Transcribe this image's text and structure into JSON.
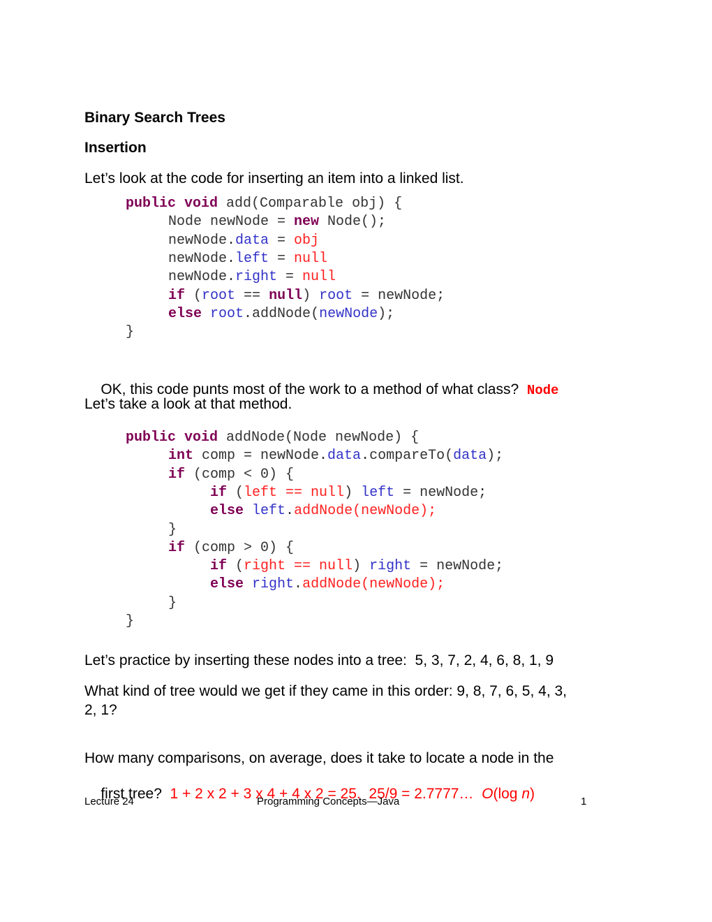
{
  "document": {
    "title": "Binary Search Trees",
    "subtitle": "Insertion",
    "intro": "Let’s look at the code for inserting an item into a linked list.",
    "code_add": [
      [
        {
          "t": "public void",
          "c": "kw"
        },
        {
          "t": " add(Comparable obj) {",
          "c": ""
        }
      ],
      [
        {
          "t": "Node newNode = ",
          "c": ""
        },
        {
          "t": "new",
          "c": "kw"
        },
        {
          "t": " Node();",
          "c": ""
        }
      ],
      [
        {
          "t": "newNode.",
          "c": ""
        },
        {
          "t": "data",
          "c": "bl"
        },
        {
          "t": " = ",
          "c": ""
        },
        {
          "t": "obj",
          "c": "rd"
        }
      ],
      [
        {
          "t": "newNode.",
          "c": ""
        },
        {
          "t": "left",
          "c": "bl"
        },
        {
          "t": " = ",
          "c": ""
        },
        {
          "t": "null",
          "c": "rd"
        }
      ],
      [
        {
          "t": "newNode.",
          "c": ""
        },
        {
          "t": "right",
          "c": "bl"
        },
        {
          "t": " = ",
          "c": ""
        },
        {
          "t": "null",
          "c": "rd"
        }
      ],
      [
        {
          "t": "if",
          "c": "kw"
        },
        {
          "t": " (",
          "c": ""
        },
        {
          "t": "root",
          "c": "bl"
        },
        {
          "t": " == ",
          "c": ""
        },
        {
          "t": "null",
          "c": "kw"
        },
        {
          "t": ") ",
          "c": ""
        },
        {
          "t": "root",
          "c": "bl"
        },
        {
          "t": " = newNode;",
          "c": ""
        }
      ],
      [
        {
          "t": "else",
          "c": "kw"
        },
        {
          "t": " ",
          "c": ""
        },
        {
          "t": "root",
          "c": "bl"
        },
        {
          "t": ".addNode(",
          "c": ""
        },
        {
          "t": "newNode",
          "c": "bl"
        },
        {
          "t": ");",
          "c": ""
        }
      ],
      [
        {
          "t": "}",
          "c": ""
        }
      ]
    ],
    "question1": "OK, this code punts most of the work to a method of what class?",
    "answer1": "Node",
    "lead2": "Let’s take a look at that method.",
    "code_addnode": [
      [
        {
          "t": "public void",
          "c": "kw"
        },
        {
          "t": " addNode(Node newNode) {",
          "c": ""
        }
      ],
      [
        {
          "t": "int",
          "c": "kw"
        },
        {
          "t": " comp = newNode.",
          "c": ""
        },
        {
          "t": "data",
          "c": "bl"
        },
        {
          "t": ".compareTo(",
          "c": ""
        },
        {
          "t": "data",
          "c": "bl"
        },
        {
          "t": ");",
          "c": ""
        }
      ],
      [
        {
          "t": "if",
          "c": "kw"
        },
        {
          "t": " (comp < 0) {",
          "c": ""
        }
      ],
      [
        {
          "t": "if",
          "c": "kw"
        },
        {
          "t": " (",
          "c": ""
        },
        {
          "t": "left == null",
          "c": "rd"
        },
        {
          "t": ") ",
          "c": ""
        },
        {
          "t": "left",
          "c": "bl"
        },
        {
          "t": " = newNode;",
          "c": ""
        }
      ],
      [
        {
          "t": "else",
          "c": "kw"
        },
        {
          "t": " ",
          "c": ""
        },
        {
          "t": "left",
          "c": "bl"
        },
        {
          "t": ".",
          "c": ""
        },
        {
          "t": "addNode(newNode);",
          "c": "rd"
        }
      ],
      [
        {
          "t": "}",
          "c": ""
        }
      ],
      [
        {
          "t": "if",
          "c": "kw"
        },
        {
          "t": " (comp > 0) {",
          "c": ""
        }
      ],
      [
        {
          "t": "if",
          "c": "kw"
        },
        {
          "t": " (",
          "c": ""
        },
        {
          "t": "right == null",
          "c": "rd"
        },
        {
          "t": ") ",
          "c": ""
        },
        {
          "t": "right",
          "c": "bl"
        },
        {
          "t": " = newNode;",
          "c": ""
        }
      ],
      [
        {
          "t": "else",
          "c": "kw"
        },
        {
          "t": " ",
          "c": ""
        },
        {
          "t": "right",
          "c": "bl"
        },
        {
          "t": ".",
          "c": ""
        },
        {
          "t": "addNode(newNode);",
          "c": "rd"
        }
      ],
      [
        {
          "t": "}",
          "c": ""
        }
      ],
      [
        {
          "t": "}",
          "c": ""
        }
      ]
    ],
    "practice": "Let’s practice by inserting these nodes into a tree:  5, 3, 7, 2, 4, 6, 8, 1, 9",
    "question2_line1": "What kind of tree would we get if they came in this order: 9, 8, 7, 6, 5, 4, 3,",
    "question2_line2": "2, 1?",
    "question3_line1": "How many comparisons, on average, does it take to locate a node in the",
    "question3_line2_prefix": "first tree?  ",
    "answer3": "1 + 2 x 2 + 3 x 4 + 4 x 2 = 25.  25/9 = 2.7777…  ",
    "answer3_big_o_prefix": "O",
    "answer3_big_o_mid": "(log ",
    "answer3_big_o_var": "n",
    "answer3_big_o_suffix": ")"
  },
  "footer": {
    "left": "Lecture 24",
    "center": "Programming Concepts—Java",
    "right": "1"
  },
  "colors": {
    "keyword": "#7f0055",
    "identifier": "#3232c8",
    "literal": "#ff2020",
    "answer": "#ff0000"
  }
}
